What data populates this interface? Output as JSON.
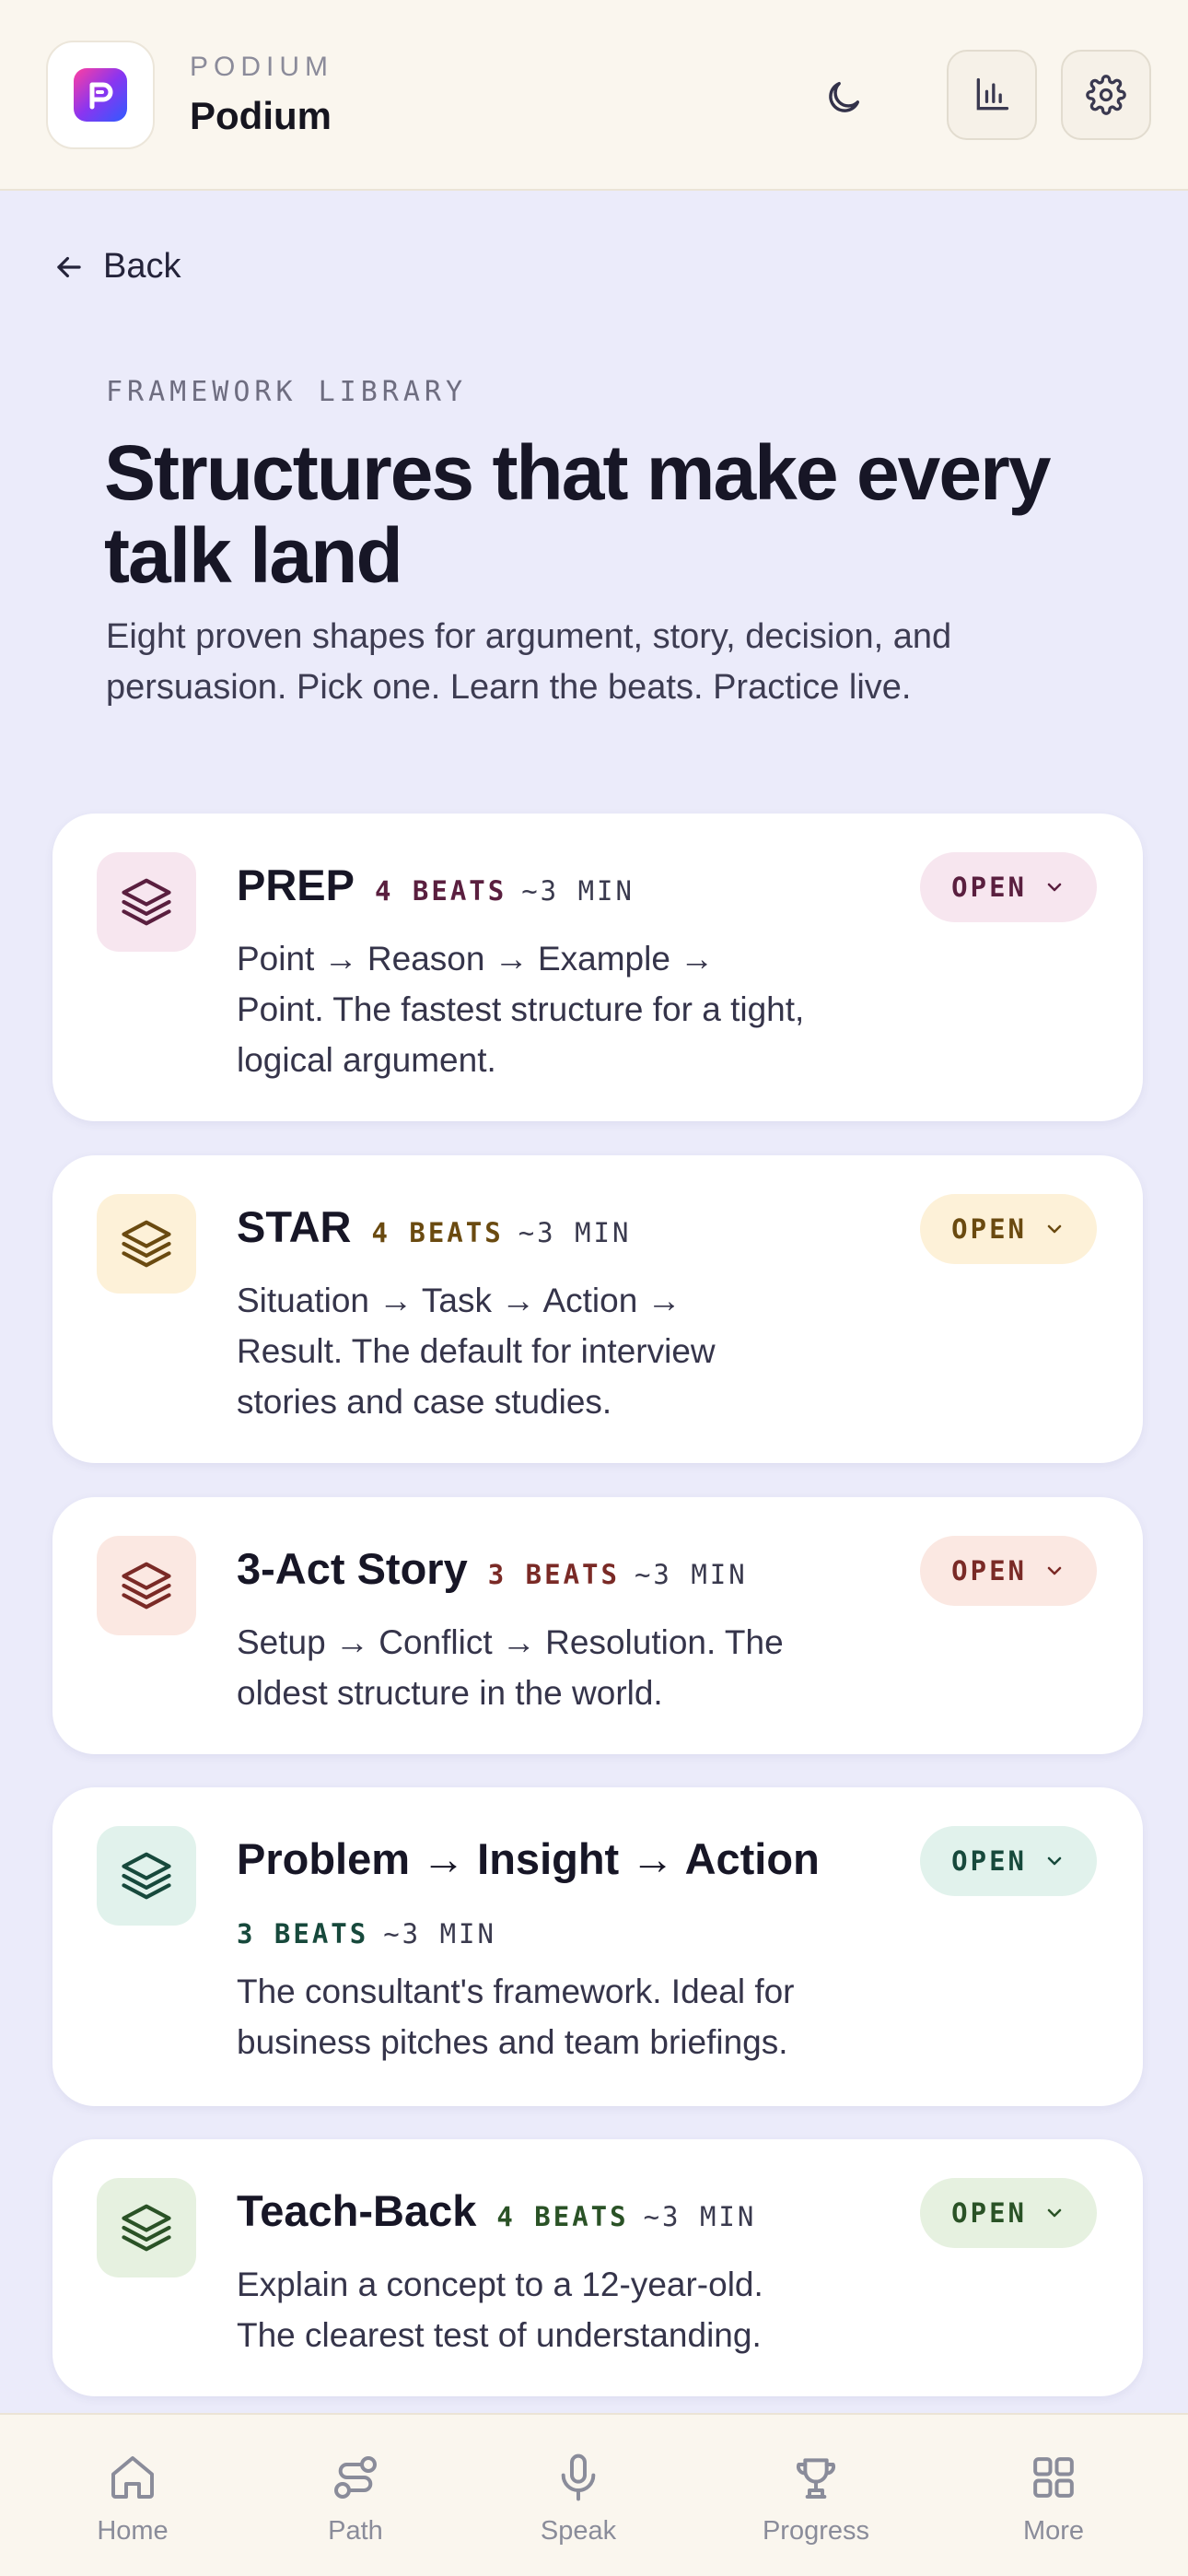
{
  "header": {
    "kicker": "PODIUM",
    "title": "Podium",
    "icons": [
      "app-logo",
      "moon-icon",
      "bar-chart-icon",
      "gear-icon"
    ]
  },
  "back_label": "Back",
  "intro": {
    "kicker": "FRAMEWORK LIBRARY",
    "headline": "Structures that make every talk land",
    "description": "Eight proven shapes for argument, story, decision, and persuasion. Pick one. Learn the beats. Practice live."
  },
  "frameworks": [
    {
      "name": "PREP",
      "beats": "4 BEATS",
      "duration": "~3 MIN",
      "description": "Point → Reason → Example → Point. The fastest structure for a tight, logical argument.",
      "button": "OPEN",
      "accent": "#5a1f3f",
      "tint": "#f7e6ef"
    },
    {
      "name": "STAR",
      "beats": "4 BEATS",
      "duration": "~3 MIN",
      "description": "Situation → Task → Action → Result. The default for interview stories and case studies.",
      "button": "OPEN",
      "accent": "#6a4a10",
      "tint": "#fdf1d8"
    },
    {
      "name": "3-Act Story",
      "beats": "3 BEATS",
      "duration": "~3 MIN",
      "description": "Setup → Conflict → Resolution. The oldest structure in the world.",
      "button": "OPEN",
      "accent": "#7a2a26",
      "tint": "#fbe8e2"
    },
    {
      "name": "Problem → Insight → Action",
      "beats": "3 BEATS",
      "duration": "~3 MIN",
      "description": "The consultant's framework. Ideal for business pitches and team briefings.",
      "button": "OPEN",
      "accent": "#17493c",
      "tint": "#e1f2ec"
    },
    {
      "name": "Teach-Back",
      "beats": "4 BEATS",
      "duration": "~3 MIN",
      "description": "Explain a concept to a 12-year-old. The clearest test of understanding.",
      "button": "OPEN",
      "accent": "#2a5226",
      "tint": "#e6f1e0"
    }
  ],
  "nav": [
    {
      "label": "Home",
      "icon": "home-icon"
    },
    {
      "label": "Path",
      "icon": "path-icon"
    },
    {
      "label": "Speak",
      "icon": "microphone-icon"
    },
    {
      "label": "Progress",
      "icon": "trophy-icon"
    },
    {
      "label": "More",
      "icon": "grid-icon"
    }
  ]
}
